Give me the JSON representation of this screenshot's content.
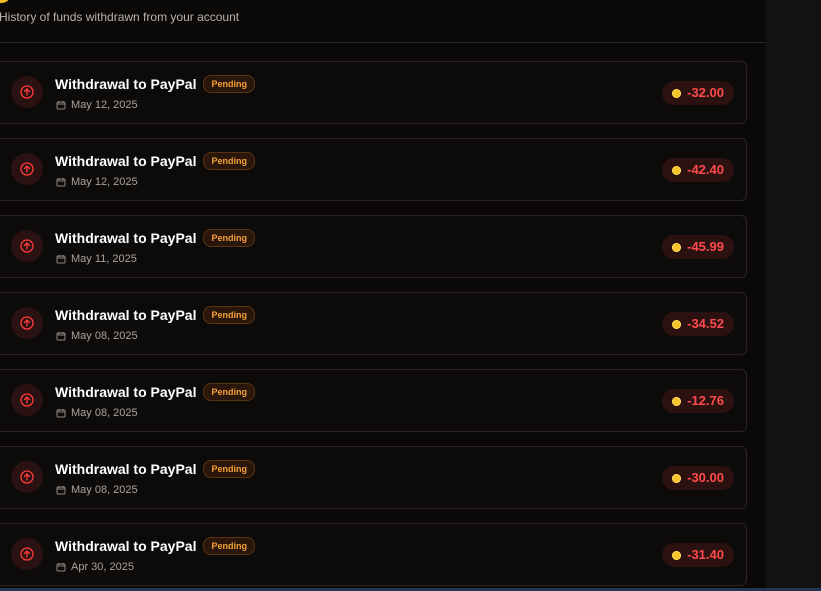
{
  "header": {
    "subtitle": "History of funds withdrawn from your account"
  },
  "withdrawals": [
    {
      "title": "Withdrawal to PayPal",
      "status": "Pending",
      "date": "May 12, 2025",
      "amount": "-32.00"
    },
    {
      "title": "Withdrawal to PayPal",
      "status": "Pending",
      "date": "May 12, 2025",
      "amount": "-42.40"
    },
    {
      "title": "Withdrawal to PayPal",
      "status": "Pending",
      "date": "May 11, 2025",
      "amount": "-45.99"
    },
    {
      "title": "Withdrawal to PayPal",
      "status": "Pending",
      "date": "May 08, 2025",
      "amount": "-34.52"
    },
    {
      "title": "Withdrawal to PayPal",
      "status": "Pending",
      "date": "May 08, 2025",
      "amount": "-12.76"
    },
    {
      "title": "Withdrawal to PayPal",
      "status": "Pending",
      "date": "May 08, 2025",
      "amount": "-30.00"
    },
    {
      "title": "Withdrawal to PayPal",
      "status": "Pending",
      "date": "Apr 30, 2025",
      "amount": "-31.40"
    }
  ],
  "icons": {
    "transaction": "arrow-up-circle-icon",
    "date": "calendar-icon",
    "amount": "coin-icon"
  },
  "colors": {
    "background": "#0b0908",
    "pending_text": "#f6a13b",
    "pending_background": "#2a160b",
    "negative_amount": "#ff4b4b",
    "coin": "#f7c52b"
  }
}
